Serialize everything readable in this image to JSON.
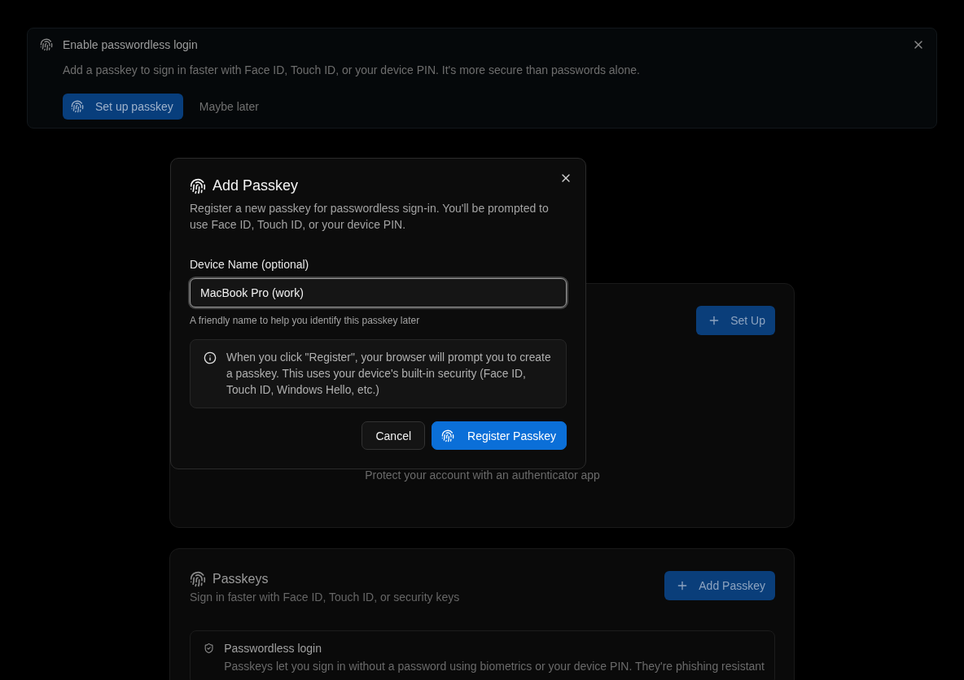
{
  "banner": {
    "title": "Enable passwordless login",
    "description": "Add a passkey to sign in faster with Face ID, Touch ID, or your device PIN. It's more secure than passwords alone.",
    "primary_button": "Set up passkey",
    "secondary_button": "Maybe later"
  },
  "authenticator_card": {
    "button": "Set Up",
    "empty_text": "Protect your account with an authenticator app"
  },
  "passkeys_card": {
    "title": "Passkeys",
    "subtitle": "Sign in faster with Face ID, Touch ID, or security keys",
    "button": "Add Passkey",
    "info": {
      "title": "Passwordless login",
      "text": "Passkeys let you sign in without a password using biometrics or your device PIN. They're phishing resistant"
    }
  },
  "dialog": {
    "title": "Add Passkey",
    "description": "Register a new passkey for passwordless sign-in. You'll be prompted to use Face ID, Touch ID, or your device PIN.",
    "field": {
      "label": "Device Name (optional)",
      "value": "MacBook Pro (work)",
      "focused": true,
      "hint": "A friendly name to help you identify this passkey later"
    },
    "notice": "When you click \"Register\", your browser will prompt you to create a passkey. This uses your device's built-in security (Face ID, Touch ID, Windows Hello, etc.)",
    "buttons": [
      {
        "label": "Cancel",
        "kind": "secondary"
      },
      {
        "label": "Register Passkey",
        "kind": "primary"
      }
    ]
  }
}
